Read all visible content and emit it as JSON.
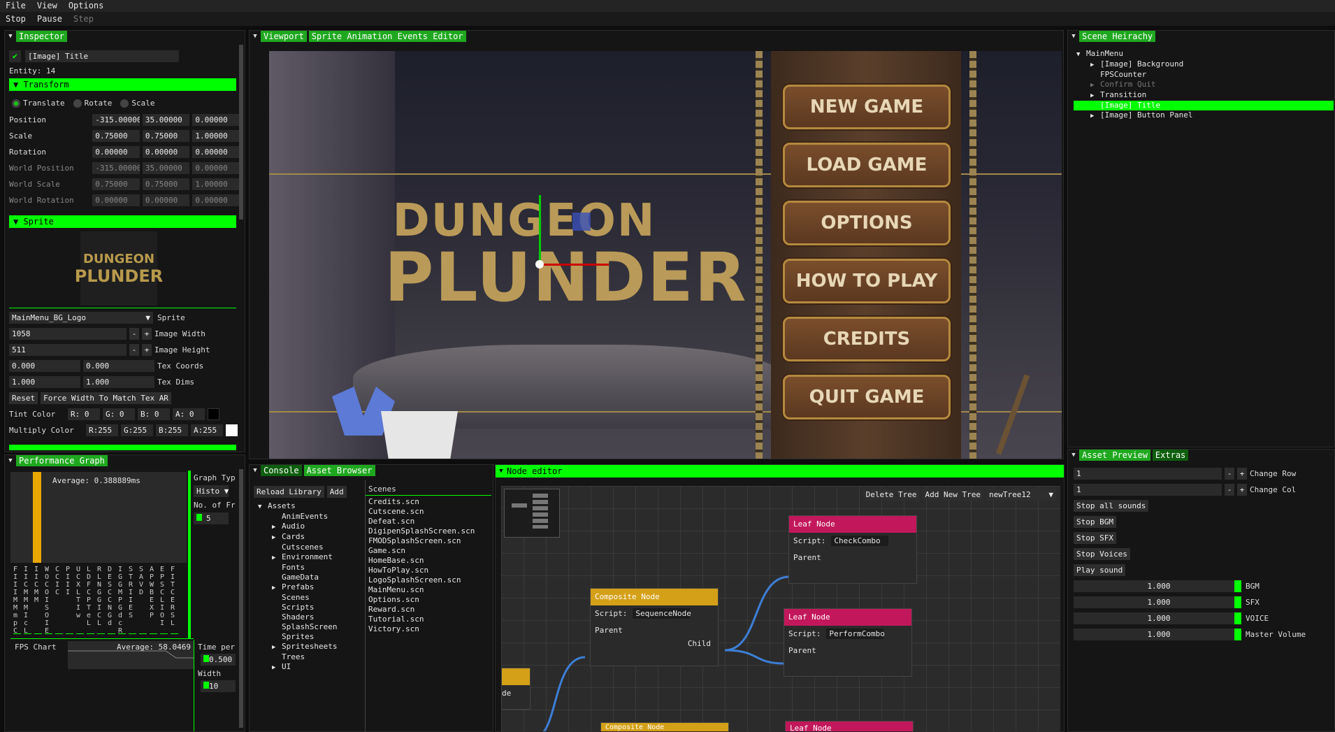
{
  "menu": [
    "File",
    "View",
    "Options"
  ],
  "toolbar": {
    "stop": "Stop",
    "pause": "Pause",
    "step": "Step"
  },
  "inspector": {
    "tab": "Inspector",
    "entity_name": "[Image] Title",
    "entity_id": "Entity: 14",
    "transform_header": "Transform",
    "modes": [
      "Translate",
      "Rotate",
      "Scale"
    ],
    "rows": [
      {
        "label": "Position",
        "v": [
          "-315.00000",
          "35.00000",
          "0.00000"
        ],
        "dim": false
      },
      {
        "label": "Scale",
        "v": [
          "0.75000",
          "0.75000",
          "1.00000"
        ],
        "dim": false
      },
      {
        "label": "Rotation",
        "v": [
          "0.00000",
          "0.00000",
          "0.00000"
        ],
        "dim": false
      },
      {
        "label": "World Position",
        "v": [
          "-315.00000",
          "35.00000",
          "0.00000"
        ],
        "dim": true
      },
      {
        "label": "World Scale",
        "v": [
          "0.75000",
          "0.75000",
          "1.00000"
        ],
        "dim": true
      },
      {
        "label": "World Rotation",
        "v": [
          "0.00000",
          "0.00000",
          "0.00000"
        ],
        "dim": true
      }
    ],
    "sprite_header": "Sprite",
    "sprite_select": "MainMenu_BG_Logo",
    "sprite_label": "Sprite",
    "image_width": "1058",
    "image_width_label": "Image Width",
    "image_height": "511",
    "image_height_label": "Image Height",
    "tex_coords": [
      "0.000",
      "0.000"
    ],
    "tex_coords_label": "Tex Coords",
    "tex_dims": [
      "1.000",
      "1.000"
    ],
    "tex_dims_label": "Tex Dims",
    "reset": "Reset",
    "force_width": "Force Width To Match Tex AR",
    "tint_label": "Tint Color",
    "tint": [
      "R:  0",
      "G:  0",
      "B:  0",
      "A:  0"
    ],
    "multiply_label": "Multiply Color",
    "multiply": [
      "R:255",
      "G:255",
      "B:255",
      "A:255"
    ],
    "logo_text_1": "DUNGEON",
    "logo_text_2": "PLUNDER"
  },
  "perf": {
    "tab": "Performance Graph",
    "average": "Average: 0.388889ms",
    "graph_type_label": "Graph Typ",
    "graph_type_value": "Histo",
    "num_frames_label": "No. of Fr",
    "num_frames_value": "5",
    "fps_label": "FPS Chart",
    "fps_average": "Average: 58.0469",
    "time_label": "Time per",
    "time_value": "0.500",
    "width_label": "Width",
    "width_value": "10",
    "columns": [
      "FIIIMMmpCL",
      "IICMMMIcL",
      "IICMM",
      "WOCOISOIE",
      "CCIC",
      "PIII",
      "UCXLTIw",
      "LDFCPTeL",
      "RLNGGICL",
      "DESCCNGd",
      "IGGMPGdcRM",
      "STRIIES",
      "SAVD",
      "APWBEXP",
      "EPSCLIOI",
      "FITCERSL"
    ]
  },
  "viewport": {
    "tabs": [
      "Viewport",
      "Sprite Animation Events Editor"
    ],
    "buttons": [
      "NEW GAME",
      "LOAD GAME",
      "OPTIONS",
      "HOW TO PLAY",
      "CREDITS",
      "QUIT GAME"
    ],
    "title_line1": "DUNGEON",
    "title_line2": "PLUNDER"
  },
  "scene": {
    "tab": "Scene Heirachy",
    "items": [
      {
        "label": "MainMenu",
        "indent": 0,
        "arrow": "▼",
        "sel": false,
        "dim": false
      },
      {
        "label": "[Image] Background",
        "indent": 1,
        "arrow": "▶",
        "sel": false,
        "dim": false
      },
      {
        "label": "FPSCounter",
        "indent": 1,
        "arrow": "",
        "sel": false,
        "dim": false
      },
      {
        "label": "Confirm Quit",
        "indent": 1,
        "arrow": "▶",
        "sel": false,
        "dim": true
      },
      {
        "label": "Transition",
        "indent": 1,
        "arrow": "▶",
        "sel": false,
        "dim": false
      },
      {
        "label": "[Image] Title",
        "indent": 1,
        "arrow": "",
        "sel": true,
        "dim": false
      },
      {
        "label": "[Image] Button Panel",
        "indent": 1,
        "arrow": "▶",
        "sel": false,
        "dim": false
      }
    ]
  },
  "console": {
    "tabs": [
      "Console",
      "Asset Browser"
    ],
    "reload": "Reload Library",
    "add": "Add",
    "folders": [
      {
        "label": "Assets",
        "indent": 0,
        "arrow": "▼"
      },
      {
        "label": "AnimEvents",
        "indent": 1,
        "arrow": ""
      },
      {
        "label": "Audio",
        "indent": 1,
        "arrow": "▶"
      },
      {
        "label": "Cards",
        "indent": 1,
        "arrow": "▶"
      },
      {
        "label": "Cutscenes",
        "indent": 1,
        "arrow": ""
      },
      {
        "label": "Environment",
        "indent": 1,
        "arrow": "▶"
      },
      {
        "label": "Fonts",
        "indent": 1,
        "arrow": ""
      },
      {
        "label": "GameData",
        "indent": 1,
        "arrow": ""
      },
      {
        "label": "Prefabs",
        "indent": 1,
        "arrow": "▶"
      },
      {
        "label": "Scenes",
        "indent": 1,
        "arrow": ""
      },
      {
        "label": "Scripts",
        "indent": 1,
        "arrow": ""
      },
      {
        "label": "Shaders",
        "indent": 1,
        "arrow": ""
      },
      {
        "label": "SplashScreen",
        "indent": 1,
        "arrow": ""
      },
      {
        "label": "Sprites",
        "indent": 1,
        "arrow": ""
      },
      {
        "label": "Spritesheets",
        "indent": 1,
        "arrow": "▶"
      },
      {
        "label": "Trees",
        "indent": 1,
        "arrow": ""
      },
      {
        "label": "UI",
        "indent": 1,
        "arrow": "▶"
      }
    ],
    "files_header": "Scenes",
    "files": [
      "Credits.scn",
      "Cutscene.scn",
      "Defeat.scn",
      "DigipenSplashScreen.scn",
      "FMODSplashScreen.scn",
      "Game.scn",
      "HomeBase.scn",
      "HowToPlay.scn",
      "LogoSplashScreen.scn",
      "MainMenu.scn",
      "Options.scn",
      "Reward.scn",
      "Tutorial.scn",
      "Victory.scn"
    ]
  },
  "node_editor": {
    "tab": "Node editor",
    "delete_tree": "Delete Tree",
    "add_tree": "Add New Tree",
    "tree_select": "newTree12",
    "leaf1": {
      "title": "Leaf Node",
      "script_label": "Script:",
      "script": "CheckCombo",
      "parent": "Parent"
    },
    "composite": {
      "title": "Composite Node",
      "script_label": "Script:",
      "script": "SequenceNode",
      "parent": "Parent",
      "child": "Child"
    },
    "leaf2": {
      "title": "Leaf Node",
      "script_label": "Script:",
      "script": "PerformCombo",
      "parent": "Parent"
    },
    "leaf3": {
      "title": "Leaf Node"
    },
    "partial_left": "de",
    "partial_bottom": "Composite Node"
  },
  "asset_preview": {
    "tabs": [
      "Asset Preview",
      "Extras"
    ],
    "row_value": "1",
    "row_label": "Change Row",
    "col_value": "1",
    "col_label": "Change Col",
    "buttons": [
      "Stop all sounds",
      "Stop BGM",
      "Stop SFX",
      "Stop Voices",
      "Play sound"
    ],
    "volumes": [
      {
        "value": "1.000",
        "label": "BGM"
      },
      {
        "value": "1.000",
        "label": "SFX"
      },
      {
        "value": "1.000",
        "label": "VOICE"
      },
      {
        "value": "1.000",
        "label": "Master Volume"
      }
    ]
  },
  "colors": {
    "accent": "#00ff00",
    "leaf": "#c2185b",
    "composite": "#d4a017",
    "link": "#3d7fd6"
  }
}
